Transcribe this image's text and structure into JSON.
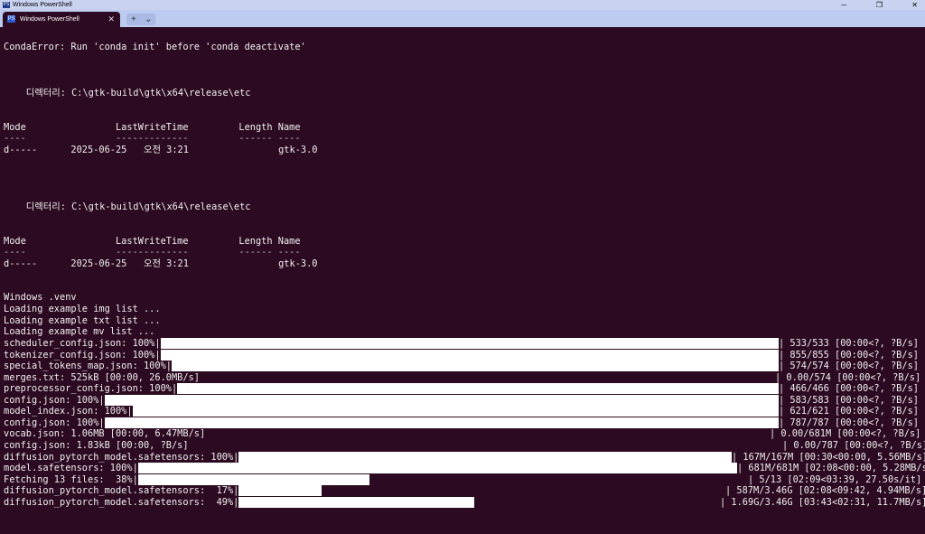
{
  "window": {
    "title": "Windows PowerShell",
    "tab_label": "Windows PowerShell",
    "ps_icon": "PS",
    "close_tab": "✕",
    "new_tab": "+",
    "dropdown": "⌄",
    "minimize": "─",
    "restore": "❐",
    "close": "✕"
  },
  "console": {
    "conda_error": "CondaError: Run 'conda init' before 'conda deactivate'",
    "dir_header_1": "    디렉터리: C:\\gtk-build\\gtk\\x64\\release\\etc",
    "cols_1": "Mode                LastWriteTime         Length Name",
    "dashes_1": "----                -------------         ------ ----",
    "row_1": "d-----      2025-06-25   오전 3:21                gtk-3.0",
    "dir_header_2": "    디렉터리: C:\\gtk-build\\gtk\\x64\\release\\etc",
    "cols_2": "Mode                LastWriteTime         Length Name",
    "dashes_2": "----                -------------         ------ ----",
    "row_2": "d-----      2025-06-25   오전 3:21                gtk-3.0",
    "venv": "Windows .venv",
    "load_img": "Loading example img list ...",
    "load_txt": "Loading example txt list ...",
    "load_mv": "Loading example mv list ...",
    "downloads": [
      {
        "label": "scheduler_config.json: 100%|",
        "progress": 1.0,
        "tail": "| 533/533 [00:00<?, ?B/s]"
      },
      {
        "label": "tokenizer_config.json: 100%|",
        "progress": 1.0,
        "tail": "| 855/855 [00:00<?, ?B/s]"
      },
      {
        "label": "special_tokens_map.json: 100%|",
        "progress": 1.0,
        "tail": "| 574/574 [00:00<?, ?B/s]"
      },
      {
        "label": "merges.txt: 525kB [00:00, 26.0MB/s]",
        "progress": 0,
        "tail": "| 0.00/574 [00:00<?, ?B/s]"
      },
      {
        "label": "preprocessor_config.json: 100%|",
        "progress": 1.0,
        "tail": "| 466/466 [00:00<?, ?B/s]"
      },
      {
        "label": "config.json: 100%|",
        "progress": 1.0,
        "tail": "| 583/583 [00:00<?, ?B/s]"
      },
      {
        "label": "model_index.json: 100%|",
        "progress": 1.0,
        "tail": "| 621/621 [00:00<?, ?B/s]"
      },
      {
        "label": "config.json: 100%|",
        "progress": 1.0,
        "tail": "| 787/787 [00:00<?, ?B/s]"
      },
      {
        "label": "vocab.json: 1.06MB [00:00, 6.47MB/s]",
        "progress": 0,
        "tail": "| 0.00/681M [00:00<?, ?B/s]"
      },
      {
        "label": "config.json: 1.83kB [00:00, ?B/s]",
        "progress": 0,
        "tail": "| 0.00/787 [00:00<?, ?B/s]"
      },
      {
        "label": "diffusion_pytorch_model.safetensors: 100%|",
        "progress": 1.0,
        "tail": "| 167M/167M [00:30<00:00, 5.56MB/s]"
      },
      {
        "label": "model.safetensors: 100%|",
        "progress": 1.0,
        "tail": "| 681M/681M [02:08<00:00, 5.28MB/s]"
      },
      {
        "label": "Fetching 13 files:  38%|",
        "progress": 0.38,
        "tail": "| 5/13 [02:09<03:39, 27.50s/it]"
      },
      {
        "label": "diffusion_pytorch_model.safetensors:  17%|",
        "progress": 0.17,
        "tail": "| 587M/3.46G [02:08<09:42, 4.94MB/s]"
      },
      {
        "label": "diffusion_pytorch_model.safetensors:  49%|",
        "progress": 0.49,
        "tail": "| 1.69G/3.46G [03:43<02:31, 11.7MB/s]"
      }
    ]
  }
}
